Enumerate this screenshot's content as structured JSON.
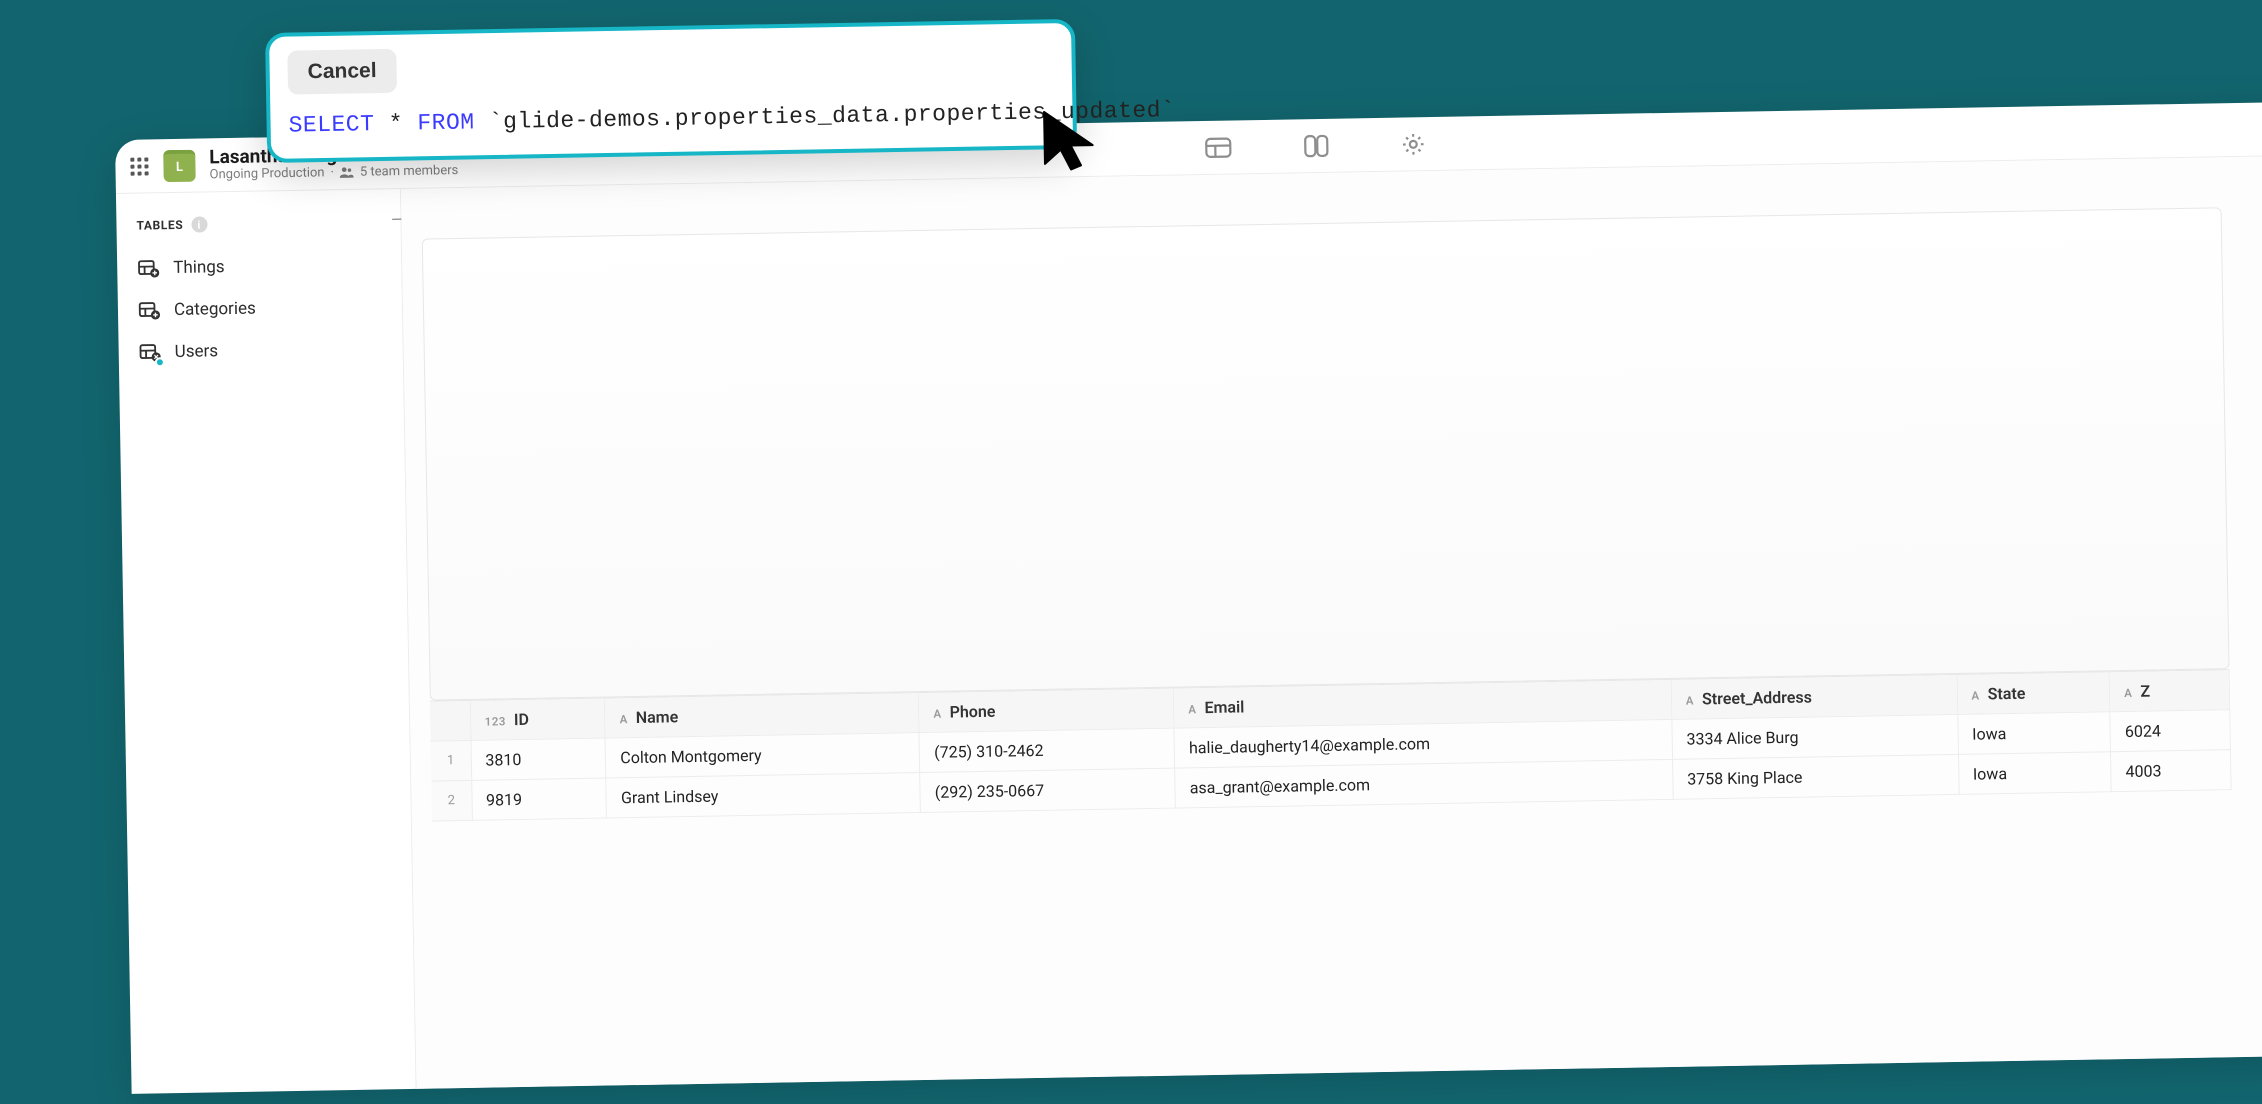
{
  "header": {
    "page_title": "Lasantha's Page",
    "status": "Ongoing Production",
    "members_text": "5 team members",
    "avatar_letter": "L"
  },
  "sidebar": {
    "heading": "TABLES",
    "items": [
      {
        "label": "Things"
      },
      {
        "label": "Categories"
      },
      {
        "label": "Users"
      }
    ]
  },
  "sql_popup": {
    "cancel_label": "Cancel",
    "kw_select": "SELECT",
    "star": "*",
    "kw_from": "FROM",
    "table_ref": "`glide-demos.properties_data.properties_updated`"
  },
  "table": {
    "columns": [
      {
        "type": "123",
        "name": "ID"
      },
      {
        "type": "A",
        "name": "Name"
      },
      {
        "type": "A",
        "name": "Phone"
      },
      {
        "type": "A",
        "name": "Email"
      },
      {
        "type": "A",
        "name": "Street_Address"
      },
      {
        "type": "A",
        "name": "State"
      },
      {
        "type": "A",
        "name": "Z"
      }
    ],
    "rows": [
      {
        "num": "1",
        "cells": [
          "3810",
          "Colton Montgomery",
          "(725) 310-2462",
          "halie_daugherty14@example.com",
          "3334 Alice Burg",
          "Iowa",
          "6024"
        ]
      },
      {
        "num": "2",
        "cells": [
          "9819",
          "Grant Lindsey",
          "(292) 235-0667",
          "asa_grant@example.com",
          "3758 King Place",
          "Iowa",
          "4003"
        ]
      }
    ]
  }
}
